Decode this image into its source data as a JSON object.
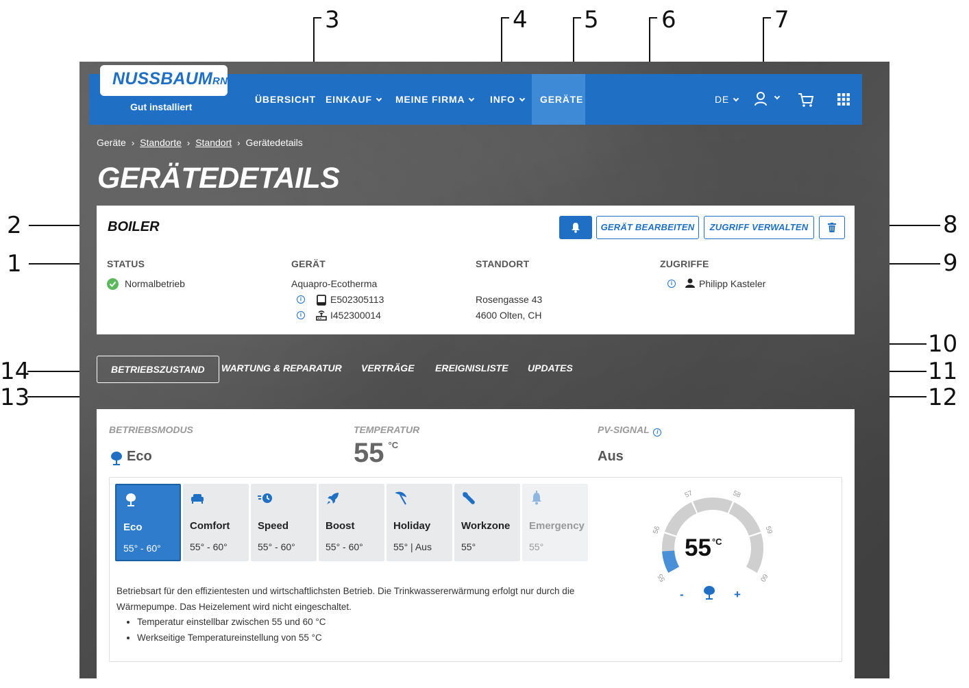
{
  "callouts": [
    "1",
    "2",
    "3",
    "4",
    "5",
    "6",
    "7",
    "8",
    "9",
    "10",
    "11",
    "12",
    "13",
    "14"
  ],
  "header": {
    "logo": {
      "wordmark": "NUSSBAUM",
      "suffix": "RN",
      "tagline": "Gut installiert"
    },
    "nav": [
      "ÜBERSICHT",
      "EINKAUF",
      "MEINE FIRMA",
      "INFO",
      "GERÄTE"
    ],
    "language": "DE",
    "icons": [
      "user-icon",
      "cart-icon",
      "apps-grid-icon"
    ]
  },
  "breadcrumb": {
    "items": [
      "Geräte",
      "Standorte",
      "Standort",
      "Gerätedetails"
    ],
    "separator": "›"
  },
  "page_title": "GERÄTEDETAILS",
  "device": {
    "name": "BOILER",
    "buttons": {
      "edit": "GERÄT BEARBEITEN",
      "access": "ZUGRIFF VERWALTEN"
    },
    "status": {
      "heading": "STATUS",
      "value": "Normalbetrieb"
    },
    "geraet": {
      "heading": "GERÄT",
      "model": "Aquapro-Ecotherma",
      "serial1": "E502305113",
      "serial2": "I452300014"
    },
    "standort": {
      "heading": "STANDORT",
      "street": "Rosengasse 43",
      "city": "4600 Olten, CH"
    },
    "zugriffe": {
      "heading": "ZUGRIFFE",
      "user": "Philipp Kasteler"
    }
  },
  "tabs": [
    "BETRIEBSZUSTAND",
    "WARTUNG & REPARATUR",
    "VERTRÄGE",
    "EREIGNISLISTE",
    "UPDATES"
  ],
  "operation": {
    "mode_label": "BETRIEBSMODUS",
    "mode_value": "Eco",
    "temp_label": "TEMPERATUR",
    "temp_value": "55",
    "temp_unit": "°C",
    "pv_label": "PV-SIGNAL",
    "pv_value": "Aus",
    "modes": [
      {
        "name": "Eco",
        "range": "55° - 60°",
        "icon": "tree-icon"
      },
      {
        "name": "Comfort",
        "range": "55° - 60°",
        "icon": "sofa-icon"
      },
      {
        "name": "Speed",
        "range": "55° - 60°",
        "icon": "speed-clock-icon"
      },
      {
        "name": "Boost",
        "range": "55° - 60°",
        "icon": "rocket-icon"
      },
      {
        "name": "Holiday",
        "range": "55° | Aus",
        "icon": "umbrella-icon"
      },
      {
        "name": "Workzone",
        "range": "55°",
        "icon": "wrench-icon"
      },
      {
        "name": "Emergency",
        "range": "55°",
        "icon": "emergency-bell-icon"
      }
    ],
    "description": "Betriebsart für den effizientesten und wirtschaftlichsten Betrieb. Die Trinkwassererwärmung erfolgt nur durch die Wärmepumpe. Das Heizelement wird nicht eingeschaltet.",
    "bullets": [
      "Temperatur einstellbar zwischen 55 und 60 °C",
      "Werkseitige Temperatureinstellung von 55 °C"
    ],
    "gauge": {
      "ticks": [
        "55",
        "56",
        "57",
        "58",
        "59",
        "60"
      ],
      "min": 55,
      "max": 60,
      "value": 55,
      "display": "55",
      "unit": "°C",
      "minus": "-",
      "plus": "+"
    }
  },
  "colors": {
    "primary": "#1f6fc5",
    "active_nav": "#3e8ad6",
    "active_tile": "#2e7ccb",
    "status_ok": "#5cb85c",
    "gauge_track": "#cfcfcf"
  }
}
